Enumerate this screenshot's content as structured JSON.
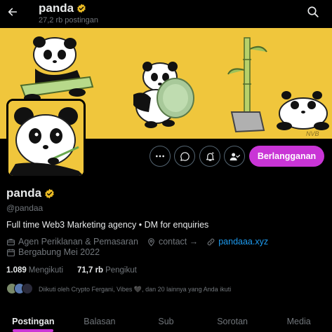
{
  "header": {
    "name": "panda",
    "post_count": "27,2 rb postingan"
  },
  "banner": {
    "signature": "NVB"
  },
  "actions": {
    "subscribe_label": "Berlangganan",
    "icons": [
      "more-icon",
      "message-icon",
      "notification-bell-icon",
      "following-icon"
    ]
  },
  "profile": {
    "display_name": "panda",
    "handle": "@pandaa",
    "bio": "Full time Web3 Marketing agency • DM for enquiries",
    "category": "Agen Periklanan & Pemasaran",
    "location": "contact →",
    "website": "pandaaa.xyz",
    "joined": "Bergabung Mei 2022"
  },
  "stats": {
    "following_count": "1.089",
    "following_label": "Mengikuti",
    "followers_count": "71,7 rb",
    "followers_label": "Pengikut"
  },
  "followed_by": {
    "text": "Diikuti oleh Crypto Fergani, Vibes 🖤, dan 20 lainnya yang Anda ikuti"
  },
  "tabs": [
    {
      "label": "Postingan",
      "active": true
    },
    {
      "label": "Balasan",
      "active": false
    },
    {
      "label": "Sub",
      "active": false
    },
    {
      "label": "Sorotan",
      "active": false
    },
    {
      "label": "Media",
      "active": false
    }
  ],
  "colors": {
    "accent": "#c935d6",
    "verified": "#e8b923",
    "link": "#1d9bf0",
    "banner": "#f0c63c"
  }
}
